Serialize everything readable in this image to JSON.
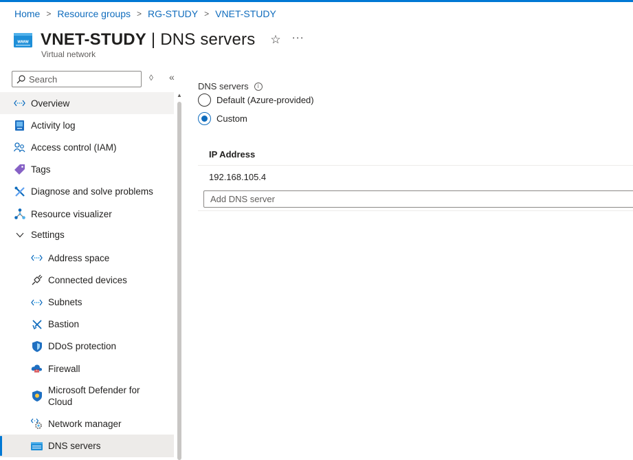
{
  "breadcrumb": [
    "Home",
    "Resource groups",
    "RG-STUDY",
    "VNET-STUDY"
  ],
  "header": {
    "resource_name": "VNET-STUDY",
    "separator": " | ",
    "page_name": "DNS servers",
    "resource_type": "Virtual network",
    "star_glyph": "☆",
    "more_glyph": "···"
  },
  "search": {
    "placeholder": "Search"
  },
  "sidebar": {
    "items": [
      {
        "label": "Overview",
        "icon": "vnet-icon"
      },
      {
        "label": "Activity log",
        "icon": "activity-log-icon"
      },
      {
        "label": "Access control (IAM)",
        "icon": "iam-icon"
      },
      {
        "label": "Tags",
        "icon": "tag-icon"
      },
      {
        "label": "Diagnose and solve problems",
        "icon": "wrench-icon"
      },
      {
        "label": "Resource visualizer",
        "icon": "visualizer-icon"
      },
      {
        "label": "Settings",
        "icon": "chevron-down-icon"
      }
    ],
    "settings_items": [
      {
        "label": "Address space",
        "icon": "address-space-icon"
      },
      {
        "label": "Connected devices",
        "icon": "plug-icon"
      },
      {
        "label": "Subnets",
        "icon": "subnet-icon"
      },
      {
        "label": "Bastion",
        "icon": "bastion-icon"
      },
      {
        "label": "DDoS protection",
        "icon": "ddos-shield-icon"
      },
      {
        "label": "Firewall",
        "icon": "firewall-icon"
      },
      {
        "label": "Microsoft Defender for Cloud",
        "icon": "defender-icon"
      },
      {
        "label": "Network manager",
        "icon": "network-manager-icon"
      },
      {
        "label": "DNS servers",
        "icon": "dns-icon"
      }
    ]
  },
  "main": {
    "dns_label": "DNS servers",
    "options": [
      {
        "label": "Default (Azure-provided)",
        "checked": false
      },
      {
        "label": "Custom",
        "checked": true
      }
    ],
    "table": {
      "header": "IP Address",
      "rows": [
        "192.168.105.4"
      ],
      "add_placeholder": "Add DNS server"
    }
  },
  "colors": {
    "accent": "#0078d4",
    "link": "#0f6cbd",
    "selected_bg": "#edebe9",
    "hover_bg": "#f3f2f1"
  }
}
